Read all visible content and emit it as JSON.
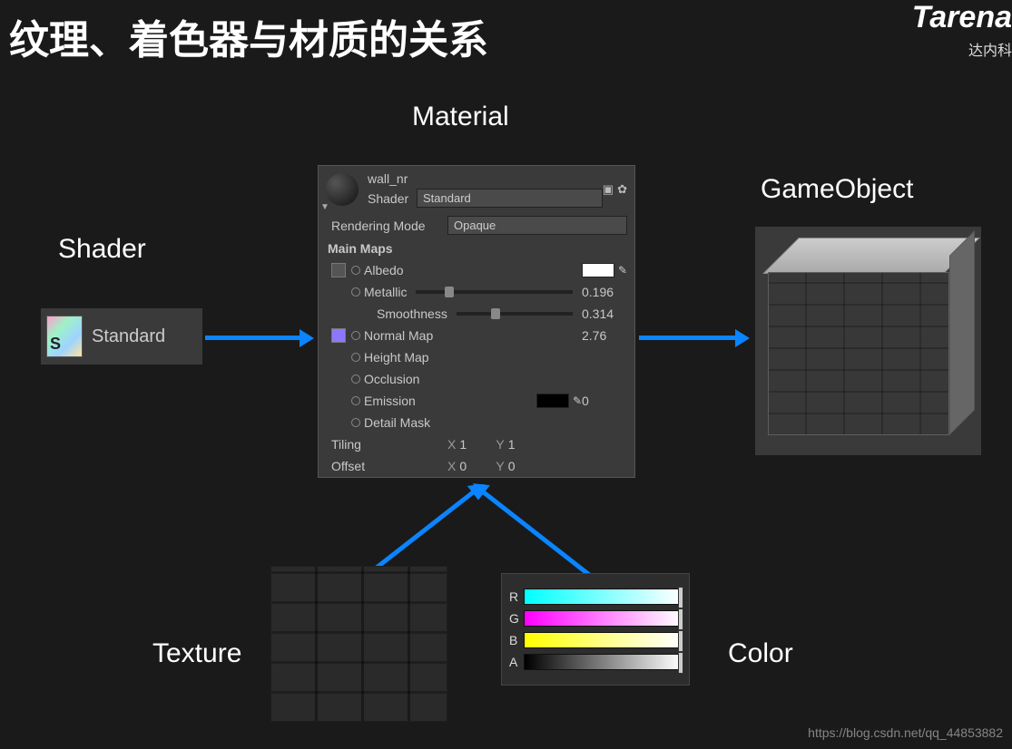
{
  "title": "纹理、着色器与材质的关系",
  "logo": "Tarena",
  "logo_sub": "达内科",
  "labels": {
    "material": "Material",
    "shader": "Shader",
    "gameobject": "GameObject",
    "texture": "Texture",
    "color": "Color"
  },
  "shader_box": {
    "icon_letter": "S",
    "name": "Standard"
  },
  "inspector": {
    "name": "wall_nr",
    "shader_label": "Shader",
    "shader_value": "Standard",
    "rendering_mode_label": "Rendering Mode",
    "rendering_mode_value": "Opaque",
    "main_maps": "Main Maps",
    "albedo": "Albedo",
    "metallic": "Metallic",
    "metallic_val": "0.196",
    "smoothness": "Smoothness",
    "smoothness_val": "0.314",
    "normal": "Normal Map",
    "normal_val": "2.76",
    "height": "Height Map",
    "occlusion": "Occlusion",
    "emission": "Emission",
    "emission_val": "0",
    "detail": "Detail Mask",
    "tiling": "Tiling",
    "offset": "Offset",
    "x": "X",
    "y": "Y",
    "tiling_x": "1",
    "tiling_y": "1",
    "offset_x": "0",
    "offset_y": "0"
  },
  "colorpicker": {
    "r": "R",
    "g": "G",
    "b": "B",
    "a": "A"
  },
  "watermark": "https://blog.csdn.net/qq_44853882"
}
